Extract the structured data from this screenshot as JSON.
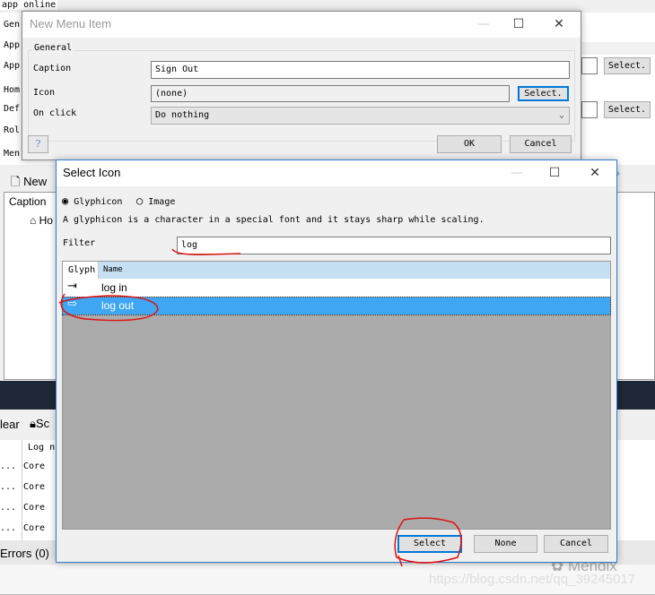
{
  "background": {
    "top_label": "app online",
    "row_labels": [
      "Gen",
      "App",
      "App",
      "Hom",
      "Def",
      "Rol",
      "Men"
    ],
    "select_buttons": [
      "Select.",
      "Select."
    ],
    "new_button": "New",
    "caption_header": "Caption",
    "home_item": "Ho",
    "toolbar": {
      "clear": "lear",
      "scroll": "Sc"
    },
    "log_table": {
      "header": "Log n",
      "rows": [
        "Core",
        "Core",
        "Core",
        "Core"
      ],
      "ellipsis": "..."
    },
    "errors_tab": "Errors (0)",
    "watermark": {
      "brand": "Mendix",
      "url": "https://blog.csdn.net/qq_39245017"
    }
  },
  "new_menu_item": {
    "title": "New Menu Item",
    "group": "General",
    "caption_label": "Caption",
    "caption_value": "Sign Out",
    "icon_label": "Icon",
    "icon_value": "(none)",
    "icon_select": "Select.",
    "onclick_label": "On click",
    "onclick_value": "Do nothing",
    "ok": "OK",
    "cancel": "Cancel"
  },
  "select_icon": {
    "title": "Select Icon",
    "radio_glyphicon": "Glyphicon",
    "radio_image": "Image",
    "selected_radio": "Glyphicon",
    "description": "A glyphicon is a character in a special font and it stays sharp while scaling.",
    "filter_label": "Filter",
    "filter_value": "log",
    "columns": [
      "Glyph",
      "Name"
    ],
    "rows": [
      {
        "glyph": "log-in-icon",
        "name": "log in",
        "selected": false
      },
      {
        "glyph": "log-out-icon",
        "name": "log out",
        "selected": true
      }
    ],
    "select": "Select",
    "none": "None",
    "cancel": "Cancel"
  },
  "colors": {
    "selection": "#3ea6f3",
    "header": "#c5dff3",
    "annotation": "#e01010",
    "accent": "#0078d7"
  }
}
